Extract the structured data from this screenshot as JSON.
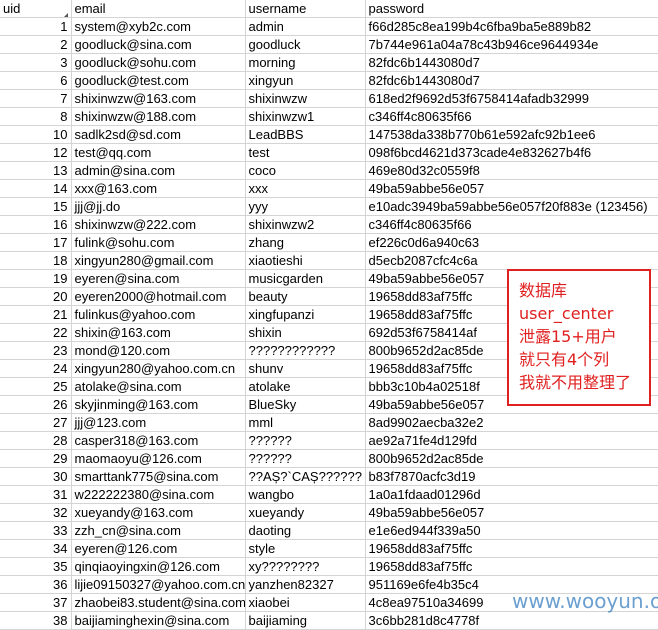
{
  "sheet": {
    "columns": [
      "uid",
      "email",
      "username",
      "password"
    ],
    "rows": [
      {
        "uid": "1",
        "email": "system@xyb2c.com",
        "username": "admin",
        "password": "f66d285c8ea199b4c6fba9ba5e889b82"
      },
      {
        "uid": "2",
        "email": "goodluck@sina.com",
        "username": "goodluck",
        "password": "7b744e961a04a78c43b946ce9644934e"
      },
      {
        "uid": "3",
        "email": "goodluck@sohu.com",
        "username": "morning",
        "password": "82fdc6b1443080d7"
      },
      {
        "uid": "6",
        "email": "goodluck@test.com",
        "username": "xingyun",
        "password": "82fdc6b1443080d7"
      },
      {
        "uid": "7",
        "email": "shixinwzw@163.com",
        "username": "shixinwzw",
        "password": "618ed2f9692d53f6758414afadb32999"
      },
      {
        "uid": "8",
        "email": "shixinwzw@188.com",
        "username": "shixinwzw1",
        "password": "c346ff4c80635f66"
      },
      {
        "uid": "10",
        "email": "sadlk2sd@sd.com",
        "username": "LeadBBS",
        "password": "147538da338b770b61e592afc92b1ee6"
      },
      {
        "uid": "12",
        "email": "test@qq.com",
        "username": "test",
        "password": "098f6bcd4621d373cade4e832627b4f6"
      },
      {
        "uid": "13",
        "email": "admin@sina.com",
        "username": "coco",
        "password": "469e80d32c0559f8"
      },
      {
        "uid": "14",
        "email": "xxx@163.com",
        "username": "xxx",
        "password": "49ba59abbe56e057"
      },
      {
        "uid": "15",
        "email": "jjj@jj.do",
        "username": "yyy",
        "password": "e10adc3949ba59abbe56e057f20f883e (123456)"
      },
      {
        "uid": "16",
        "email": "shixinwzw@222.com",
        "username": "shixinwzw2",
        "password": "c346ff4c80635f66"
      },
      {
        "uid": "17",
        "email": "fulink@sohu.com",
        "username": "zhang",
        "password": "ef226c0d6a940c63"
      },
      {
        "uid": "18",
        "email": "xingyun280@gmail.com",
        "username": "xiaotieshi",
        "password": "d5ecb2087cfc4c6a"
      },
      {
        "uid": "19",
        "email": "eyeren@sina.com",
        "username": "musicgarden",
        "password": "49ba59abbe56e057"
      },
      {
        "uid": "20",
        "email": "eyeren2000@hotmail.com",
        "username": "beauty",
        "password": "19658dd83af75ffc"
      },
      {
        "uid": "21",
        "email": "fulinkus@yahoo.com",
        "username": "xingfupanzi",
        "password": "19658dd83af75ffc"
      },
      {
        "uid": "22",
        "email": "shixin@163.com",
        "username": "shixin",
        "password": "692d53f6758414af"
      },
      {
        "uid": "23",
        "email": "mond@120.com",
        "username": "????????????",
        "password": "800b9652d2ac85de"
      },
      {
        "uid": "24",
        "email": "xingyun280@yahoo.com.cn",
        "username": "shunv",
        "password": "19658dd83af75ffc"
      },
      {
        "uid": "25",
        "email": "atolake@sina.com",
        "username": "atolake",
        "password": "bbb3c10b4a02518f"
      },
      {
        "uid": "26",
        "email": "skyjinming@163.com",
        "username": "BlueSky",
        "password": "49ba59abbe56e057"
      },
      {
        "uid": "27",
        "email": "jjj@123.com",
        "username": "mml",
        "password": "8ad9902aecba32e2"
      },
      {
        "uid": "28",
        "email": "casper318@163.com",
        "username": "??????",
        "password": "ae92a71fe4d129fd"
      },
      {
        "uid": "29",
        "email": "maomaoyu@126.com",
        "username": "??????",
        "password": "800b9652d2ac85de"
      },
      {
        "uid": "30",
        "email": "smarttank775@sina.com",
        "username": "??AȘ?`CAȘ??????",
        "password": "b83f7870acfc3d19"
      },
      {
        "uid": "31",
        "email": "w222222380@sina.com",
        "username": "wangbo",
        "password": "1a0a1fdaad01296d"
      },
      {
        "uid": "32",
        "email": "xueyandy@163.com",
        "username": "xueyandy",
        "password": "49ba59abbe56e057"
      },
      {
        "uid": "33",
        "email": "zzh_cn@sina.com",
        "username": "daoting",
        "password": "e1e6ed944f339a50"
      },
      {
        "uid": "34",
        "email": "eyeren@126.com",
        "username": "style",
        "password": "19658dd83af75ffc"
      },
      {
        "uid": "35",
        "email": "qinqiaoyingxin@126.com",
        "username": "xy????????",
        "password": "19658dd83af75ffc"
      },
      {
        "uid": "36",
        "email": "lijie09150327@yahoo.com.cn",
        "username": "yanzhen82327",
        "password": "951169e6fe4b35c4"
      },
      {
        "uid": "37",
        "email": "zhaobei83.student@sina.com",
        "username": "xiaobei",
        "password": "4c8ea97510a34699"
      },
      {
        "uid": "38",
        "email": "baijiaminghexin@sina.com",
        "username": "baijiaming",
        "password": "3c6bb281d8c4778f"
      }
    ]
  },
  "note": {
    "line1": "数据库",
    "line2": "user_center",
    "line3": "泄露15+用户",
    "line4": "就只有4个列",
    "line5": "我就不用整理了"
  },
  "watermark": "www.wooyun.org",
  "colors": {
    "note": "#e02020",
    "grid": "#d4d4d4",
    "watermark": "#3a7fc0"
  }
}
